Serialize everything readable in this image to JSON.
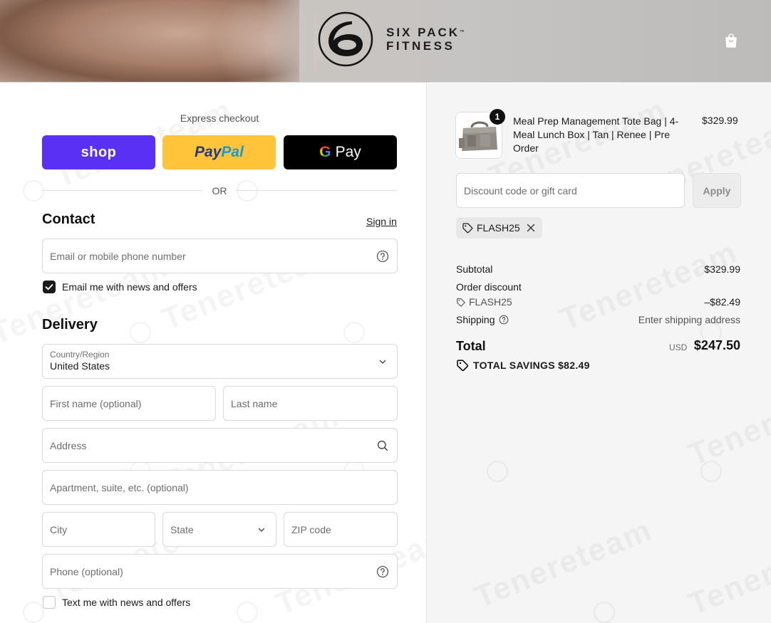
{
  "brand": {
    "line1": "SIX PACK",
    "tm": "™",
    "line2": "FITNESS"
  },
  "express": {
    "title": "Express checkout",
    "shop_label": "shop",
    "paypal_part1": "Pay",
    "paypal_part2": "Pal",
    "gpay_g": "G",
    "gpay_label": "Pay",
    "or_label": "OR"
  },
  "contact": {
    "title": "Contact",
    "sign_in": "Sign in",
    "email_placeholder": "Email or mobile phone number",
    "news_checkbox_label": "Email me with news and offers",
    "news_checked": true
  },
  "delivery": {
    "title": "Delivery",
    "country_label": "Country/Region",
    "country_value": "United States",
    "first_name_placeholder": "First name (optional)",
    "last_name_placeholder": "Last name",
    "address_placeholder": "Address",
    "apartment_placeholder": "Apartment, suite, etc. (optional)",
    "city_placeholder": "City",
    "state_placeholder": "State",
    "zip_placeholder": "ZIP code",
    "phone_placeholder": "Phone (optional)",
    "text_checkbox_label": "Text me with news and offers",
    "text_checked": false
  },
  "cart": {
    "item": {
      "quantity": "1",
      "name": "Meal Prep Management Tote Bag | 4-Meal Lunch Box | Tan | Renee | Pre Order",
      "price": "$329.99"
    },
    "discount_placeholder": "Discount code or gift card",
    "apply_label": "Apply",
    "applied_code": "FLASH25"
  },
  "summary": {
    "subtotal_label": "Subtotal",
    "subtotal_value": "$329.99",
    "order_discount_label": "Order discount",
    "discount_code": "FLASH25",
    "discount_value": "–$82.49",
    "shipping_label": "Shipping",
    "shipping_value": "Enter shipping address",
    "total_label": "Total",
    "currency": "USD",
    "total_value": "$247.50",
    "savings_label": "TOTAL SAVINGS",
    "savings_value": "$82.49"
  },
  "watermark": "Tenereteam",
  "colors": {
    "shop": "#5a31f4",
    "paypal": "#ffc439",
    "gpay": "#000000",
    "sidebar_bg": "#f5f5f5"
  }
}
